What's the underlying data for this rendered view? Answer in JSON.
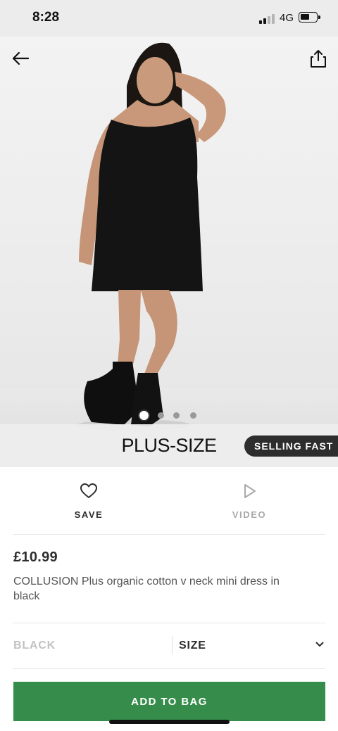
{
  "status_bar": {
    "time": "8:28",
    "network": "4G",
    "signal_bars_active": 2,
    "signal_bars_total": 4
  },
  "hero": {
    "badge_text": "PLUS-SIZE",
    "selling_fast_label": "SELLING FAST",
    "image_count": 4,
    "active_image": 1,
    "icons": {
      "back": "arrow-left-icon",
      "share": "share-icon"
    }
  },
  "actions": {
    "save_label": "SAVE",
    "video_label": "VIDEO",
    "icons": {
      "save": "heart-icon",
      "video": "play-icon"
    }
  },
  "product": {
    "price": "£10.99",
    "title": "COLLUSION Plus organic cotton v neck mini dress in black"
  },
  "selectors": {
    "colour": "BLACK",
    "size_label": "SIZE"
  },
  "cta": {
    "add_to_bag_label": "ADD TO BAG",
    "color": "#368c4b"
  }
}
